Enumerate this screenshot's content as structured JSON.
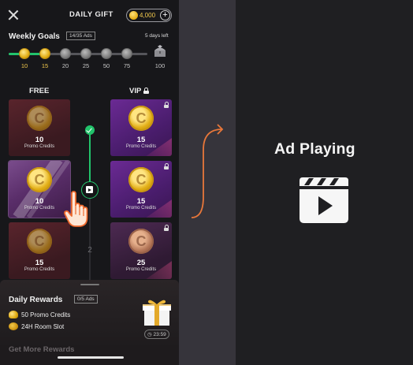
{
  "header": {
    "title": "DAILY GIFT",
    "balance": "4,000",
    "plus_label": "+"
  },
  "weekly_goals": {
    "title": "Weekly Goals",
    "badge": "14/35 Ads",
    "days_left": "5 days left",
    "progress": 0.28,
    "milestones": [
      "10",
      "15",
      "20",
      "25",
      "50",
      "75",
      "100"
    ],
    "completed": 2
  },
  "columns": {
    "free": "FREE",
    "vip": "VIP"
  },
  "free_cards": [
    {
      "amount": "10",
      "unit": "Promo Credits"
    },
    {
      "amount": "10",
      "unit": "Promo Credits"
    },
    {
      "amount": "15",
      "unit": "Promo Credits"
    }
  ],
  "vip_cards": [
    {
      "amount": "15",
      "unit": "Promo Credits"
    },
    {
      "amount": "15",
      "unit": "Promo Credits"
    },
    {
      "amount": "25",
      "unit": "Promo Credits"
    }
  ],
  "rail": {
    "next_step": "2"
  },
  "daily_rewards": {
    "title": "Daily Rewards",
    "badge": "0/5 Ads",
    "items": [
      "50 Promo Credits",
      "24H Room Slot"
    ],
    "timer": "23:59",
    "more": "Get More Rewards"
  },
  "ad": {
    "title": "Ad Playing"
  },
  "colors": {
    "accent_green": "#22c36b",
    "gold": "#f2c94c",
    "arrow": "#e8773a"
  }
}
